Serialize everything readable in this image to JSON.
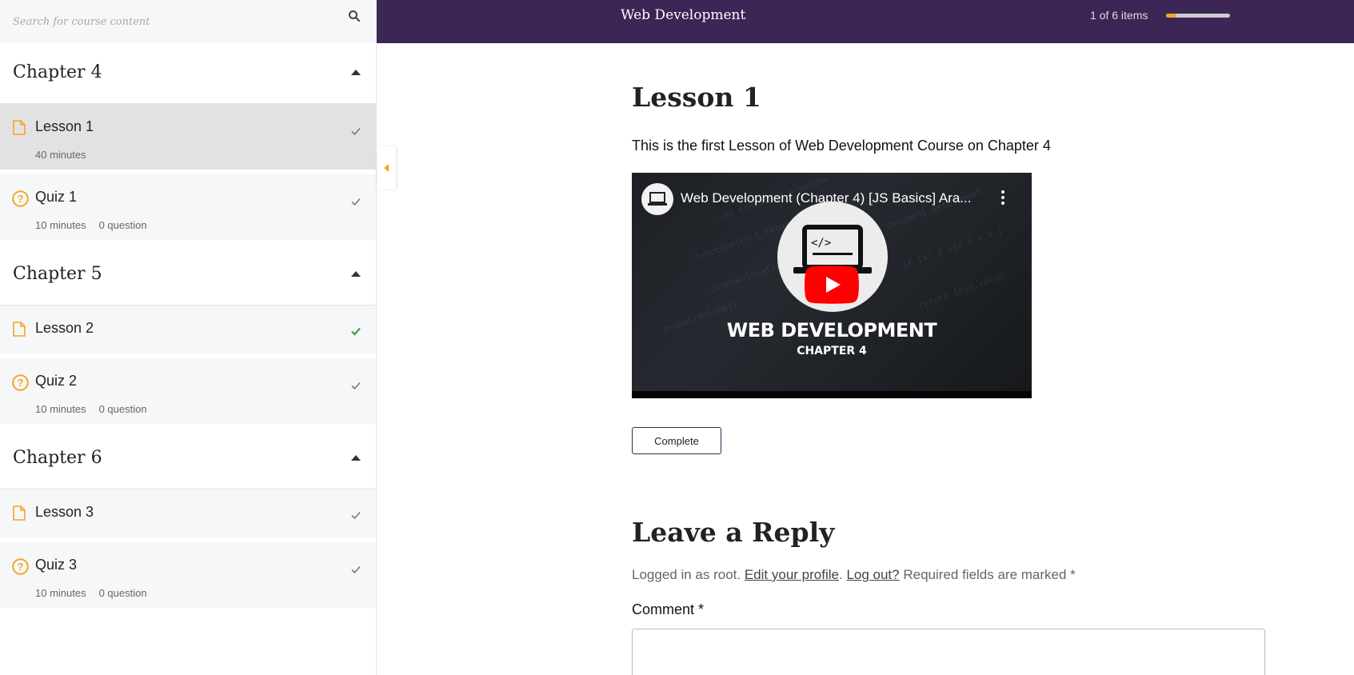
{
  "search": {
    "placeholder": "Search for course content"
  },
  "chapters": [
    {
      "title": "Chapter 4",
      "items": [
        {
          "type": "lesson",
          "title": "Lesson 1",
          "duration": "40 minutes",
          "status": "viewed",
          "active": true
        },
        {
          "type": "quiz",
          "title": "Quiz 1",
          "duration": "10 minutes",
          "questions": "0 question",
          "status": "viewed"
        }
      ]
    },
    {
      "title": "Chapter 5",
      "items": [
        {
          "type": "lesson",
          "title": "Lesson 2",
          "status": "completed"
        },
        {
          "type": "quiz",
          "title": "Quiz 2",
          "duration": "10 minutes",
          "questions": "0 question",
          "status": "viewed"
        }
      ]
    },
    {
      "title": "Chapter 6",
      "items": [
        {
          "type": "lesson",
          "title": "Lesson 3",
          "status": "viewed"
        },
        {
          "type": "quiz",
          "title": "Quiz 3",
          "duration": "10 minutes",
          "questions": "0 question",
          "status": "viewed"
        }
      ]
    }
  ],
  "header": {
    "course_title": "Web Development",
    "progress_text": "1 of 6 items",
    "progress_fraction": 0.1667
  },
  "lesson": {
    "title": "Lesson 1",
    "description": "This is the first Lesson of Web Development Course on Chapter 4",
    "video": {
      "title": "Web Development (Chapter 4) [JS Basics] Ara...",
      "banner_title": "WEB DEVELOPMENT",
      "banner_subtitle": "CHAPTER 4"
    },
    "complete_label": "Complete"
  },
  "reply": {
    "title": "Leave a Reply",
    "logged_in_prefix": "Logged in as root.",
    "edit_profile": "Edit your profile",
    "sep": ".",
    "log_out": "Log out?",
    "required_note": "Required fields are marked *",
    "comment_label": "Comment *"
  },
  "colors": {
    "accent": "#f5a623",
    "header_bg": "#3b2655",
    "check_done": "#2ea44f",
    "check_default": "#777777"
  }
}
